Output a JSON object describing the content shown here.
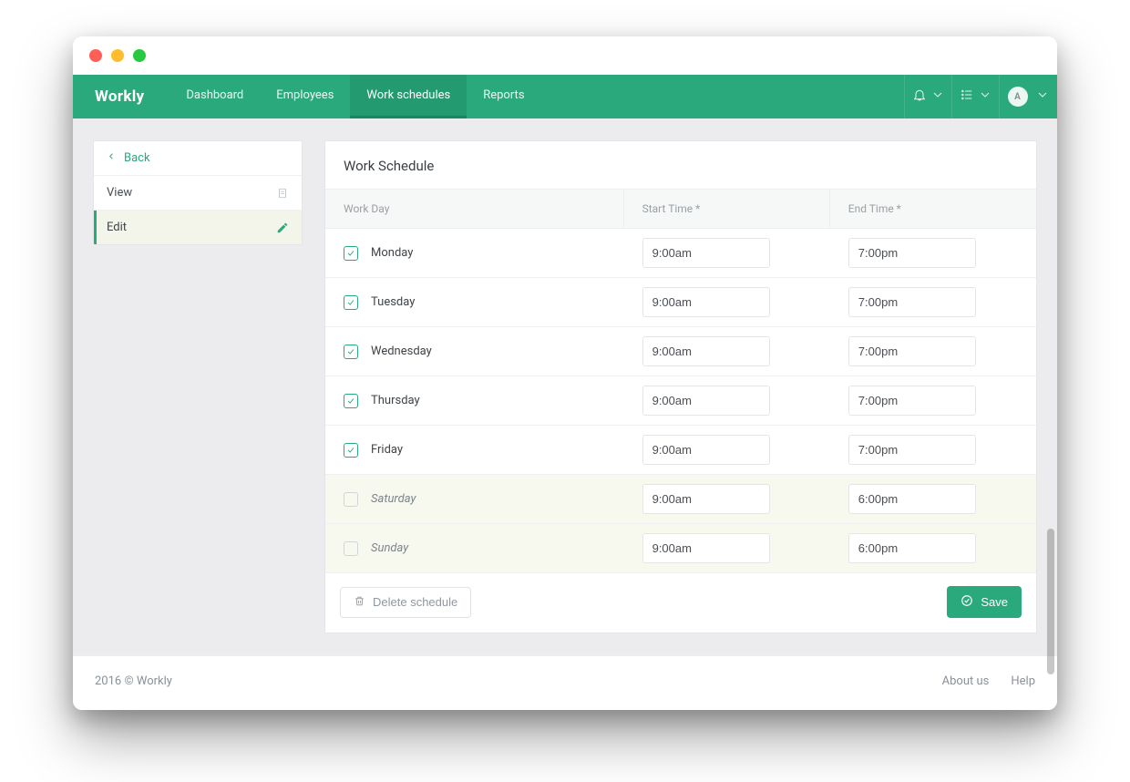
{
  "brand": "Workly",
  "nav": {
    "items": [
      "Dashboard",
      "Employees",
      "Work schedules",
      "Reports"
    ],
    "activeIndex": 2,
    "avatarInitial": "A"
  },
  "sidebar": {
    "back": "Back",
    "view": "View",
    "edit": "Edit"
  },
  "panel": {
    "title": "Work Schedule",
    "columns": {
      "workday": "Work Day",
      "start": "Start Time *",
      "end": "End Time *"
    }
  },
  "days": [
    {
      "name": "Monday",
      "checked": true,
      "start": "9:00am",
      "end": "7:00pm"
    },
    {
      "name": "Tuesday",
      "checked": true,
      "start": "9:00am",
      "end": "7:00pm"
    },
    {
      "name": "Wednesday",
      "checked": true,
      "start": "9:00am",
      "end": "7:00pm"
    },
    {
      "name": "Thursday",
      "checked": true,
      "start": "9:00am",
      "end": "7:00pm"
    },
    {
      "name": "Friday",
      "checked": true,
      "start": "9:00am",
      "end": "7:00pm"
    },
    {
      "name": "Saturday",
      "checked": false,
      "start": "9:00am",
      "end": "6:00pm"
    },
    {
      "name": "Sunday",
      "checked": false,
      "start": "9:00am",
      "end": "6:00pm"
    }
  ],
  "buttons": {
    "delete": "Delete schedule",
    "save": "Save"
  },
  "footer": {
    "copyright": "2016 © Workly",
    "about": "About us",
    "help": "Help"
  }
}
